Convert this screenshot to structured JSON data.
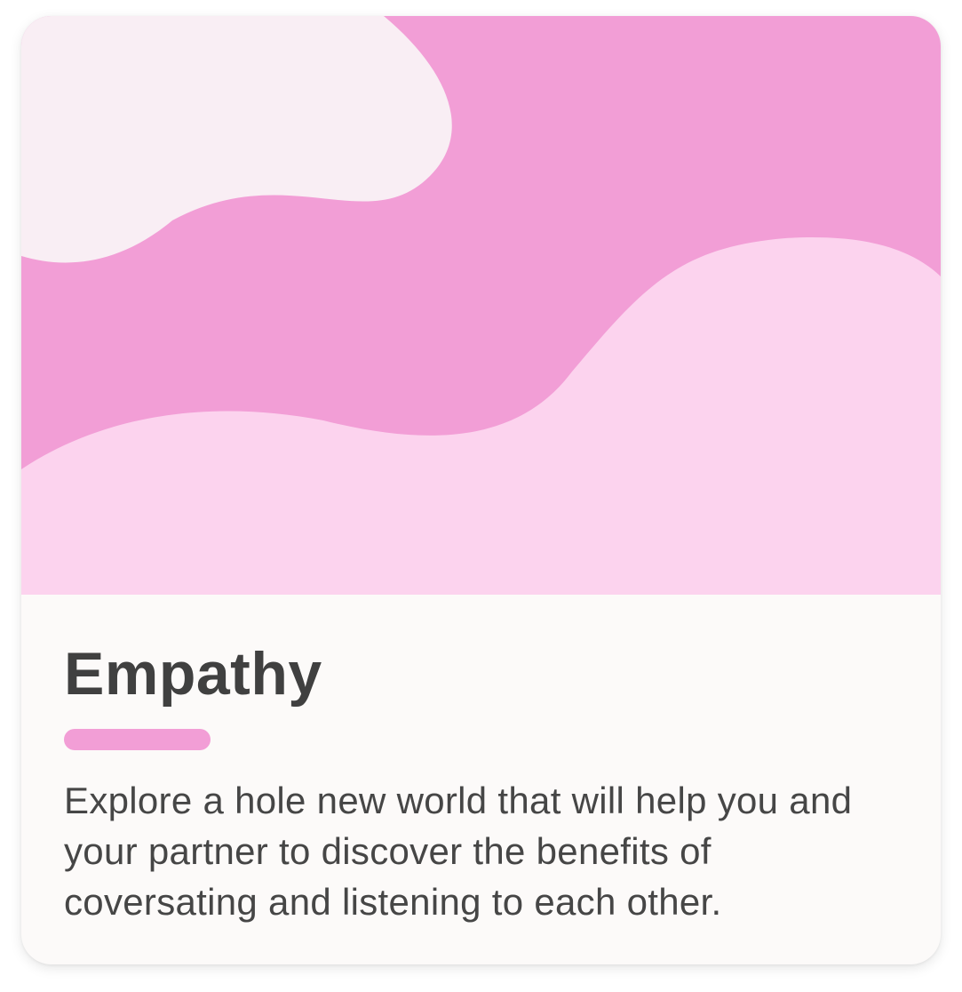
{
  "card": {
    "title": "Empathy",
    "description": "Explore a hole new world that will help you and your partner to discover the benefits of coversating and listening to each other."
  },
  "hero": {
    "illustration": "pink-wave-background",
    "colors": {
      "light_blob": "#f9eef4",
      "mid_band": "#f29ed6",
      "soft_wave": "#fcd3ee"
    }
  },
  "theme": {
    "accent": "#f29ed6",
    "text": "#404040",
    "body_background": "#fcfaf9"
  }
}
